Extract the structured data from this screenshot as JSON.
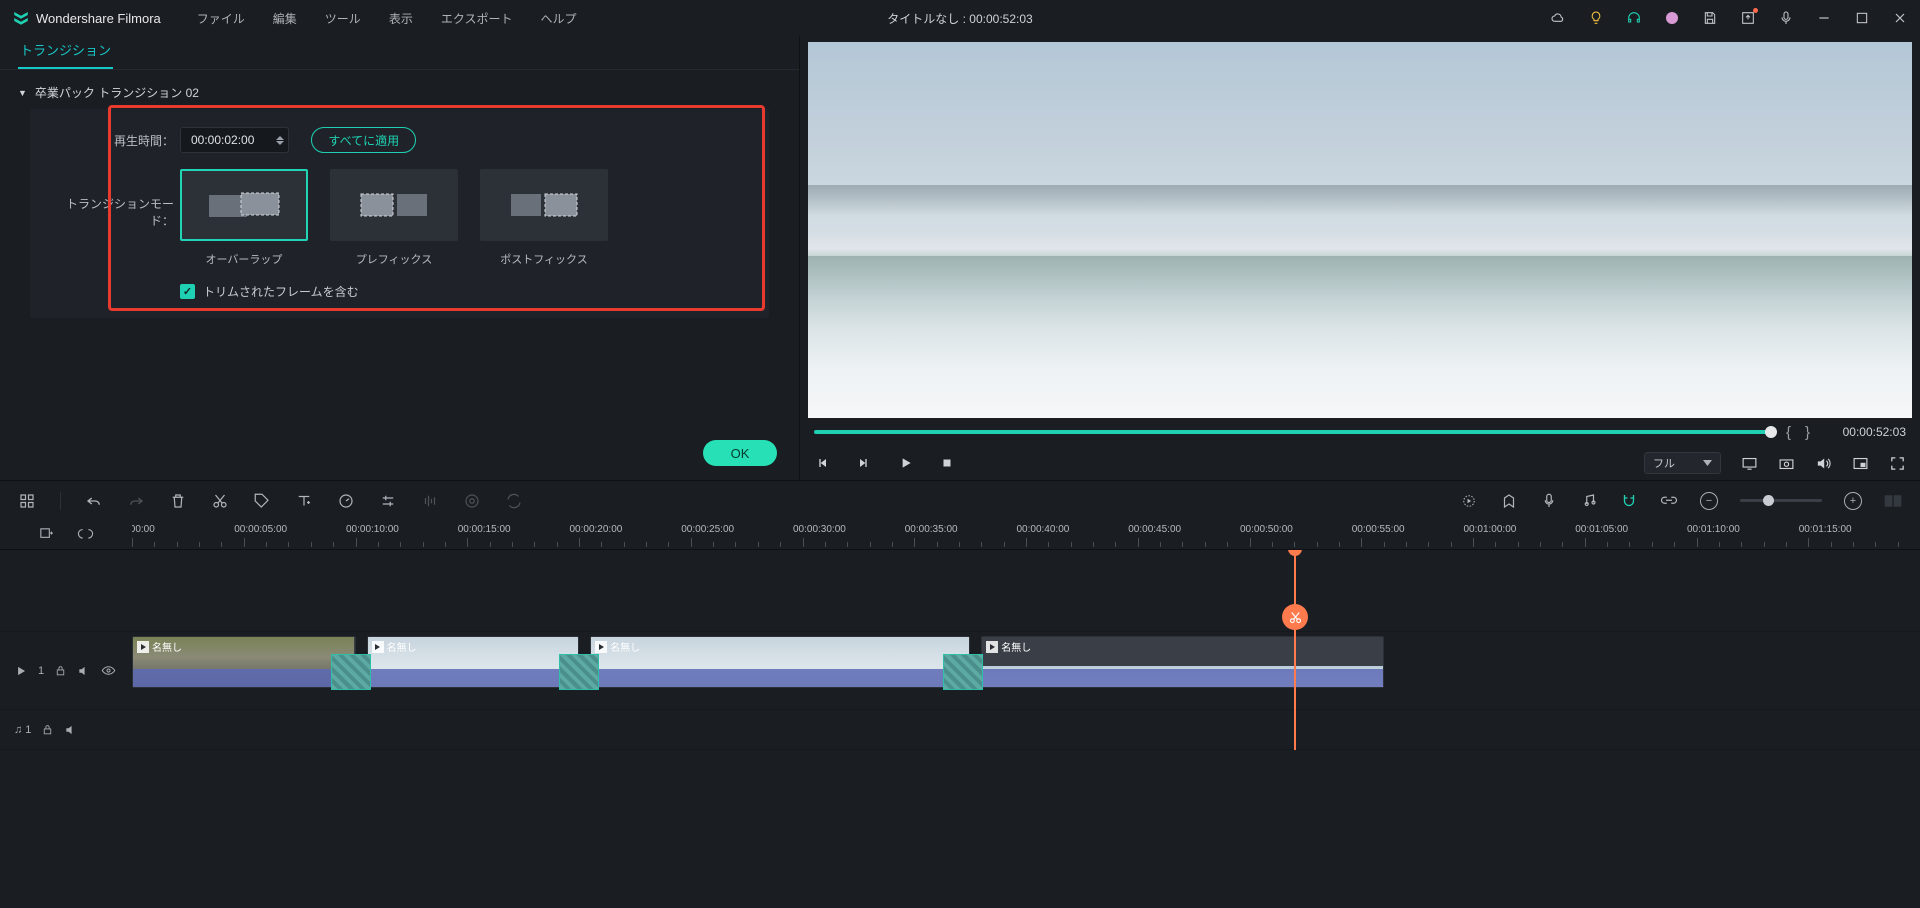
{
  "app": {
    "name": "Wondershare Filmora"
  },
  "menu": [
    "ファイル",
    "編集",
    "ツール",
    "表示",
    "エクスポート",
    "ヘルプ"
  ],
  "title_center": "タイトルなし : 00:00:52:03",
  "left": {
    "tab": "トランジション",
    "section": "卒業パック トランジション 02",
    "duration_label": "再生時間：",
    "duration_value": "00:00:02:00",
    "apply_all": "すべてに適用",
    "mode_label": "トランジションモード：",
    "modes": {
      "overlap": "オーバーラップ",
      "prefix": "プレフィックス",
      "postfix": "ポストフィックス"
    },
    "include_trim": "トリムされたフレームを含む",
    "ok": "OK"
  },
  "preview": {
    "time": "00:00:52:03",
    "quality": "フル"
  },
  "ruler": {
    "labels": [
      ":00:00",
      "00:00:05:00",
      "00:00:10:00",
      "00:00:15:00",
      "00:00:20:00",
      "00:00:25:00",
      "00:00:30:00",
      "00:00:35:00",
      "00:00:40:00",
      "00:00:45:00",
      "00:00:50:00",
      "00:00:55:00",
      "00:01:00:00",
      "00:01:05:00",
      "00:01:10:00",
      "00:01:15:00"
    ]
  },
  "clips": {
    "names": [
      "名無し",
      "名無し",
      "名無し",
      "名無し"
    ]
  },
  "tracks": {
    "audio": "♫ 1"
  }
}
